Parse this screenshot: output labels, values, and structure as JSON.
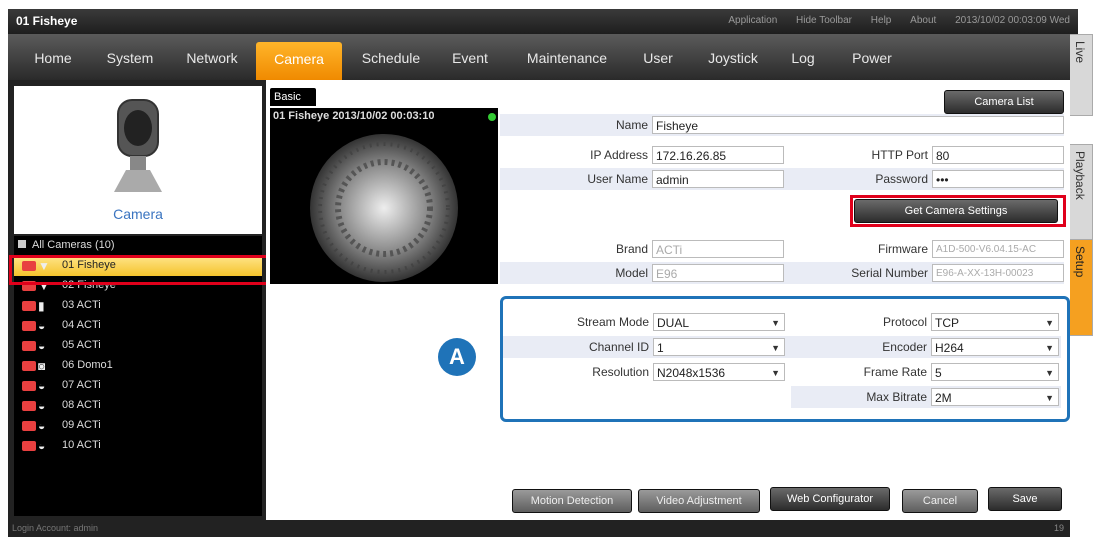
{
  "titlebar": {
    "title": "01 Fisheye",
    "menu": [
      "Application",
      "Hide Toolbar",
      "Help",
      "About"
    ],
    "datetime": "2013/10/02 00:03:09 Wed"
  },
  "nav": [
    "Home",
    "System",
    "Network",
    "Camera",
    "Schedule",
    "Event",
    "Maintenance",
    "User",
    "Joystick",
    "Log",
    "Power"
  ],
  "nav_active": "Camera",
  "side_tabs": [
    "Live",
    "Playback",
    "Setup"
  ],
  "side_tab_active": "Setup",
  "left": {
    "camera_label": "Camera",
    "tree_title": "All Cameras (10)",
    "cameras": [
      {
        "label": "01  Fisheye",
        "icon": "fisheye-camera-icon"
      },
      {
        "label": "02  Fisheye",
        "icon": "fisheye-camera-icon"
      },
      {
        "label": "03  ACTi",
        "icon": "box-camera-icon"
      },
      {
        "label": "04  ACTi",
        "icon": "dome-camera-icon"
      },
      {
        "label": "05  ACTi",
        "icon": "dome-camera-icon"
      },
      {
        "label": "06  Domo1",
        "icon": "ptz-camera-icon"
      },
      {
        "label": "07  ACTi",
        "icon": "dome-camera-icon"
      },
      {
        "label": "08  ACTi",
        "icon": "dome-camera-icon"
      },
      {
        "label": "09  ACTi",
        "icon": "dome-camera-icon"
      },
      {
        "label": "10  ACTi",
        "icon": "dome-camera-icon"
      }
    ]
  },
  "tabs": {
    "basic": "Basic",
    "camera_list": "Camera List"
  },
  "preview": {
    "caption": "01 Fisheye   2013/10/02 00:03:10"
  },
  "form": {
    "name_label": "Name",
    "name_value": "Fisheye",
    "ip_label": "IP Address",
    "ip_value": "172.16.26.85",
    "http_port_label": "HTTP Port",
    "http_port_value": "80",
    "user_label": "User Name",
    "user_value": "admin",
    "password_label": "Password",
    "password_value": "•••",
    "get_settings": "Get Camera Settings",
    "brand_label": "Brand",
    "brand_value": "ACTi",
    "firmware_label": "Firmware",
    "firmware_value": "A1D-500-V6.04.15-AC",
    "model_label": "Model",
    "model_value": "E96",
    "serial_label": "Serial Number",
    "serial_value": "E96-A-XX-13H-00023"
  },
  "stream": {
    "badge": "A",
    "stream_mode_label": "Stream Mode",
    "stream_mode_value": "DUAL",
    "protocol_label": "Protocol",
    "protocol_value": "TCP",
    "channel_label": "Channel ID",
    "channel_value": "1",
    "encoder_label": "Encoder",
    "encoder_value": "H264",
    "resolution_label": "Resolution",
    "resolution_value": "N2048x1536",
    "frame_rate_label": "Frame Rate",
    "frame_rate_value": "5",
    "bitrate_label": "Max Bitrate",
    "bitrate_value": "2M"
  },
  "buttons": {
    "motion": "Motion Detection",
    "video": "Video Adjustment",
    "web": "Web Configurator",
    "cancel": "Cancel",
    "save": "Save"
  },
  "status": {
    "account": "Login Account: admin",
    "net": "19"
  },
  "colors": {
    "accent": "#f5a020",
    "highlight_box": "#e0001b",
    "stream_box": "#1f73b8"
  }
}
